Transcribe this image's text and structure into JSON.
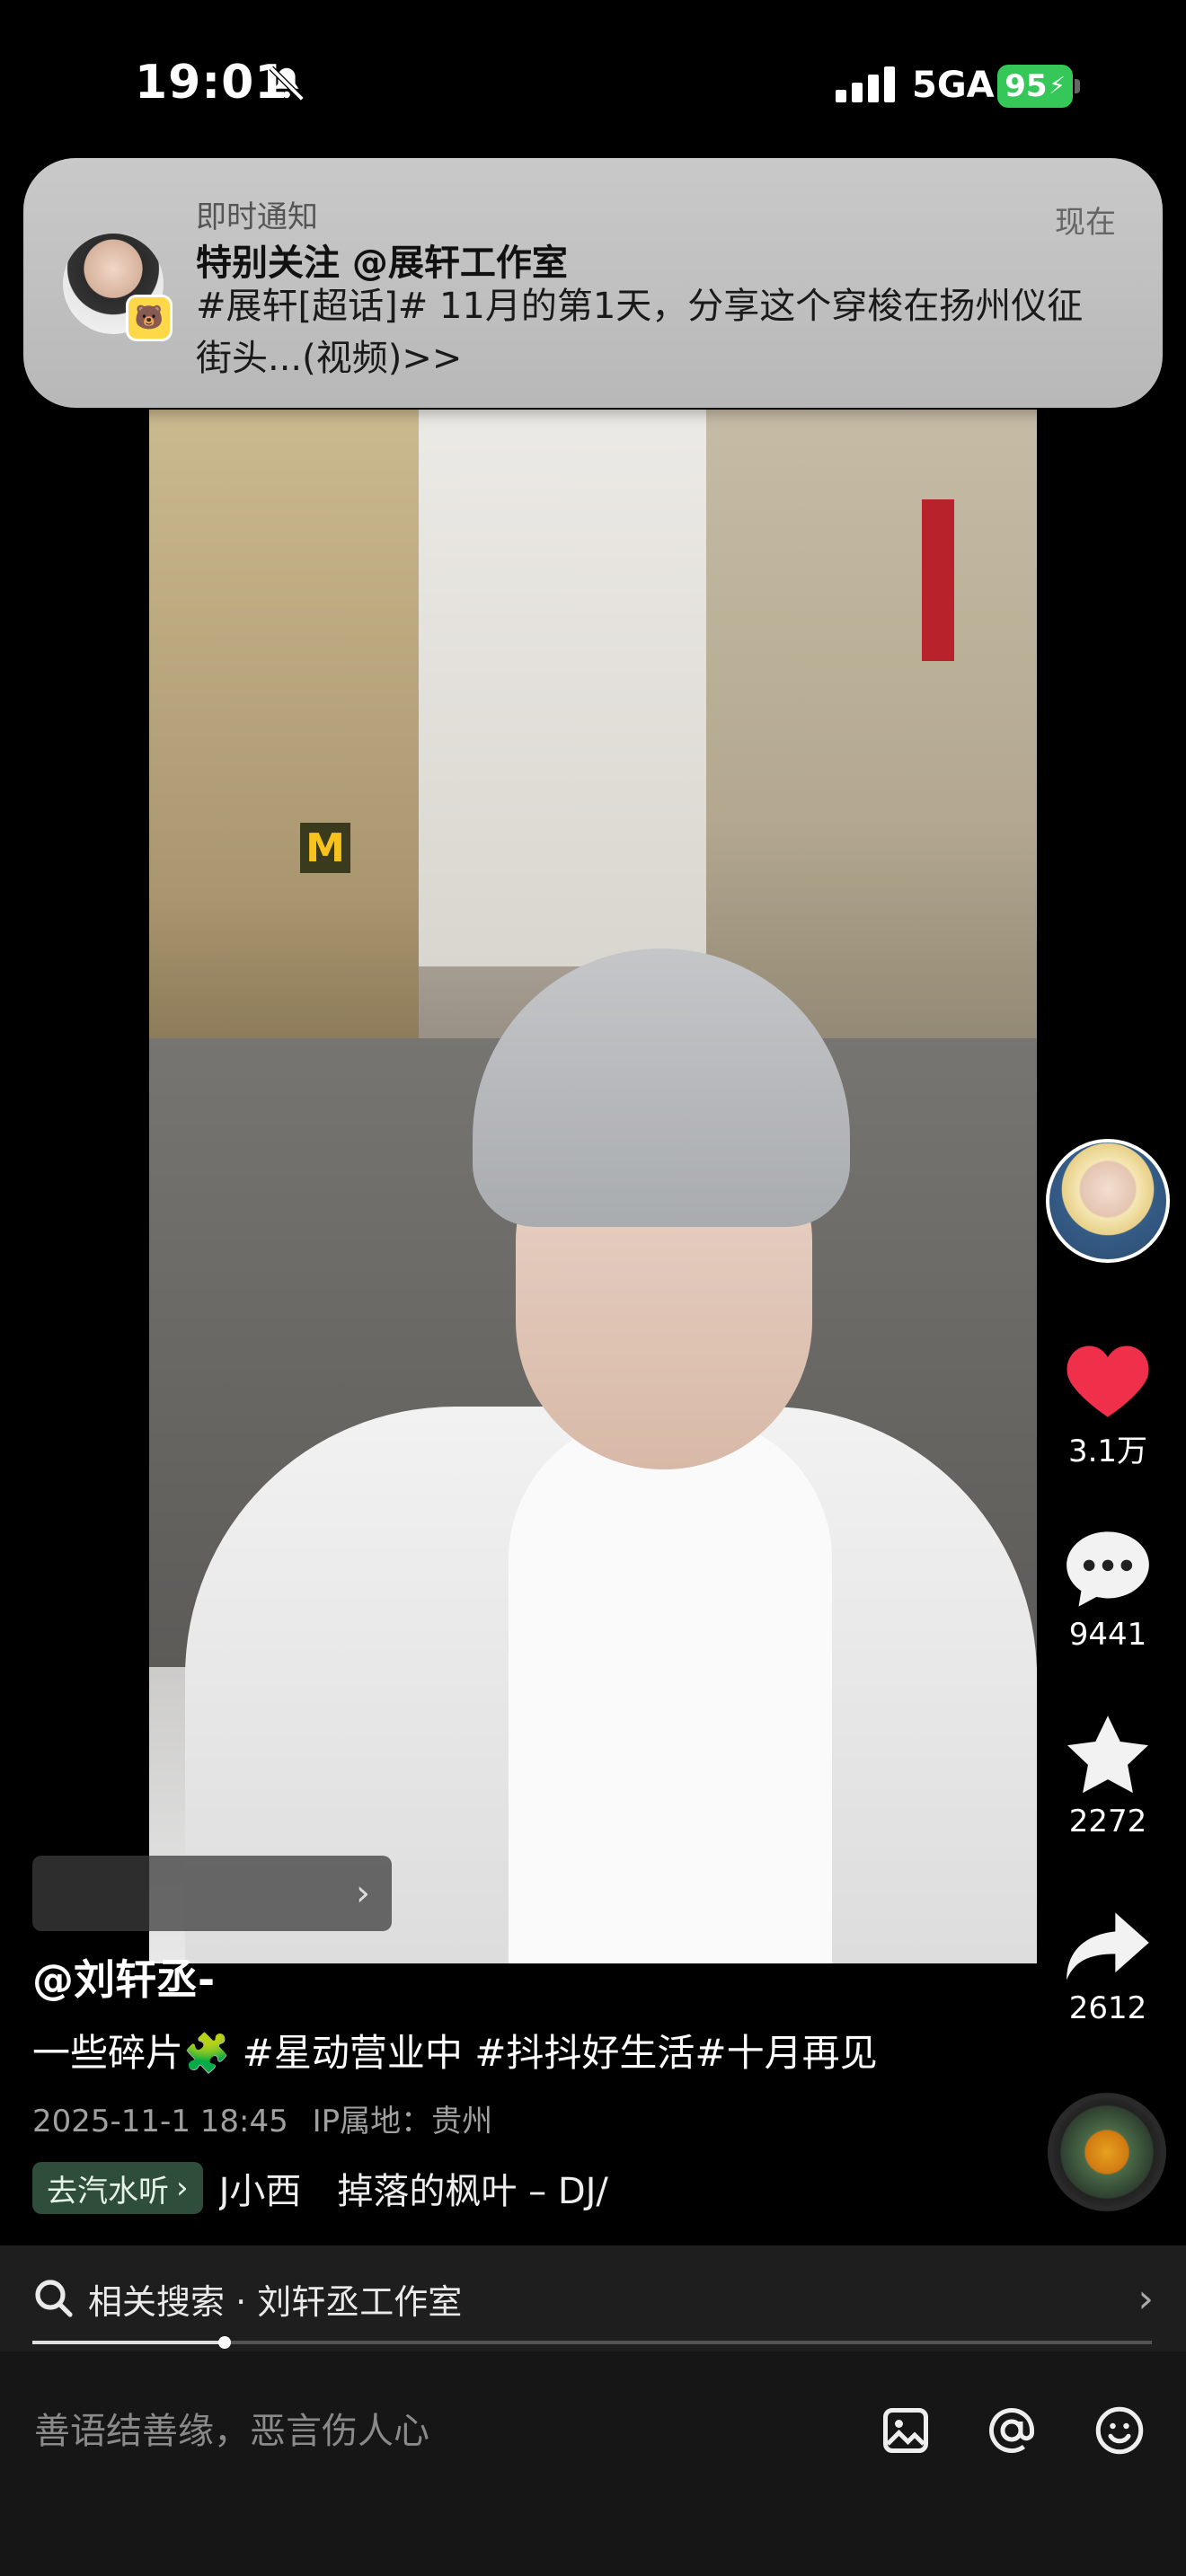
{
  "status_bar": {
    "time": "19:01",
    "network": "5GA",
    "battery": "95",
    "icons": [
      "bell-slash-icon",
      "signal-icon",
      "charging-icon"
    ]
  },
  "notification": {
    "category": "即时通知",
    "time": "现在",
    "title": "特别关注 @展轩工作室",
    "body": "#展轩[超话]# 11月的第1天，分享这个穿梭在扬州仪征街头...(视频)>>"
  },
  "post": {
    "author": "@刘轩丞-",
    "caption": "一些碎片🧩 #星动营业中 #抖抖好生活#十月再见",
    "date": "2025-11-1 18:45",
    "ip_location": "IP属地：贵州",
    "collection_arrow": "›"
  },
  "music": {
    "badge": "去汽水听",
    "badge_arrow": "›",
    "name": "J小西　掉落的枫叶 – DJ/"
  },
  "actions": {
    "likes": "3.1万",
    "comments": "9441",
    "favorites": "2272",
    "shares": "2612"
  },
  "related_search": {
    "text": "相关搜索 · 刘轩丞工作室",
    "arrow": "›"
  },
  "progress": 0.1716,
  "comment_bar": {
    "placeholder": "善语结善缘，恶言伤人心"
  },
  "colors": {
    "like_red": "#f0304a",
    "battery_green": "#36c759",
    "music_badge_bg": "#2e4d3a"
  }
}
